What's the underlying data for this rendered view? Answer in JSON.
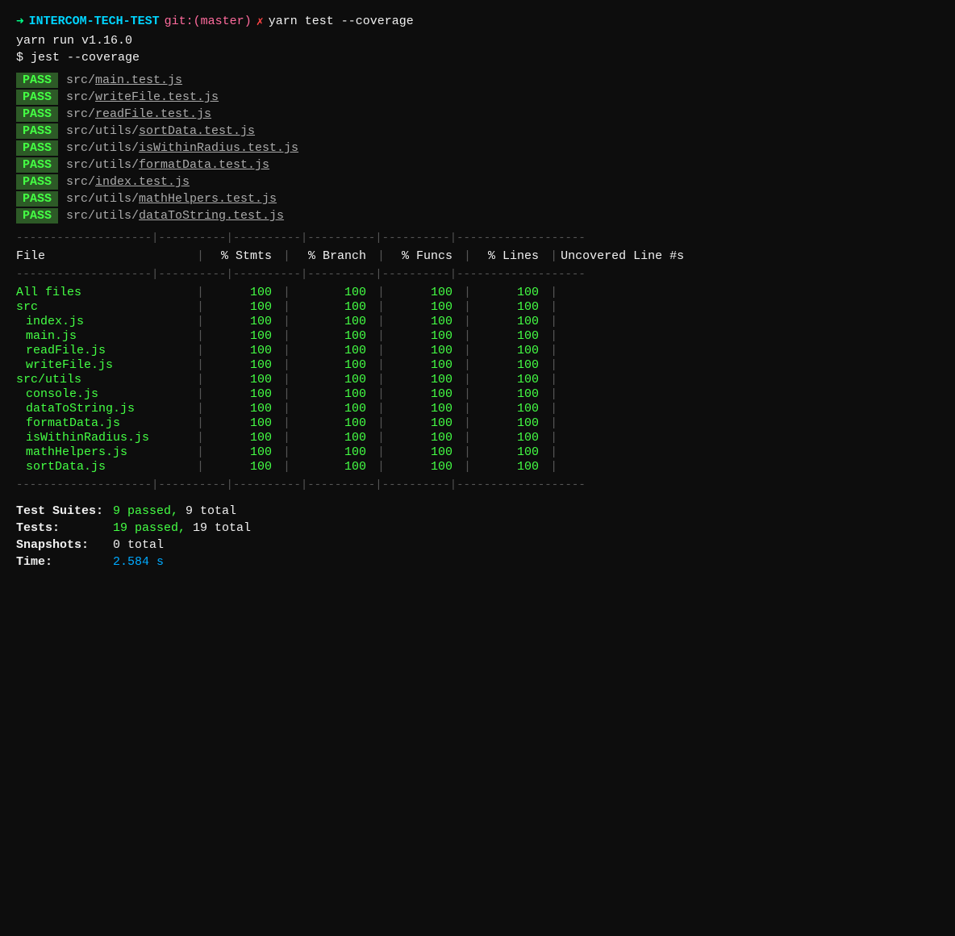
{
  "terminal": {
    "prompt": {
      "arrow": "➜",
      "dir": "INTERCOM-TECH-TEST",
      "git_label": "git:",
      "branch": "(master)",
      "cross": "✗",
      "command": "yarn test --coverage"
    },
    "yarn_version": "yarn run v1.16.0",
    "jest_cmd": "$ jest --coverage",
    "pass_files": [
      "src/main.test.js",
      "src/writeFile.test.js",
      "src/readFile.test.js",
      "src/utils/sortData.test.js",
      "src/utils/isWithinRadius.test.js",
      "src/utils/formatData.test.js",
      "src/index.test.js",
      "src/utils/mathHelpers.test.js",
      "src/utils/dataToString.test.js"
    ],
    "table": {
      "headers": {
        "file": "File",
        "stmts": "% Stmts",
        "branch": "% Branch",
        "funcs": "% Funcs",
        "lines": "% Lines",
        "uncovered": "Uncovered Line #s"
      },
      "rows": [
        {
          "file": "All files",
          "stmts": "100",
          "branch": "100",
          "funcs": "100",
          "lines": "100",
          "uncovered": "",
          "type": "section"
        },
        {
          "file": "src",
          "stmts": "100",
          "branch": "100",
          "funcs": "100",
          "lines": "100",
          "uncovered": "",
          "type": "section"
        },
        {
          "file": "index.js",
          "stmts": "100",
          "branch": "100",
          "funcs": "100",
          "lines": "100",
          "uncovered": "",
          "type": "sub"
        },
        {
          "file": "main.js",
          "stmts": "100",
          "branch": "100",
          "funcs": "100",
          "lines": "100",
          "uncovered": "",
          "type": "sub"
        },
        {
          "file": "readFile.js",
          "stmts": "100",
          "branch": "100",
          "funcs": "100",
          "lines": "100",
          "uncovered": "",
          "type": "sub"
        },
        {
          "file": "writeFile.js",
          "stmts": "100",
          "branch": "100",
          "funcs": "100",
          "lines": "100",
          "uncovered": "",
          "type": "sub"
        },
        {
          "file": "src/utils",
          "stmts": "100",
          "branch": "100",
          "funcs": "100",
          "lines": "100",
          "uncovered": "",
          "type": "section"
        },
        {
          "file": "console.js",
          "stmts": "100",
          "branch": "100",
          "funcs": "100",
          "lines": "100",
          "uncovered": "",
          "type": "sub"
        },
        {
          "file": "dataToString.js",
          "stmts": "100",
          "branch": "100",
          "funcs": "100",
          "lines": "100",
          "uncovered": "",
          "type": "sub"
        },
        {
          "file": "formatData.js",
          "stmts": "100",
          "branch": "100",
          "funcs": "100",
          "lines": "100",
          "uncovered": "",
          "type": "sub"
        },
        {
          "file": "isWithinRadius.js",
          "stmts": "100",
          "branch": "100",
          "funcs": "100",
          "lines": "100",
          "uncovered": "",
          "type": "sub"
        },
        {
          "file": "mathHelpers.js",
          "stmts": "100",
          "branch": "100",
          "funcs": "100",
          "lines": "100",
          "uncovered": "",
          "type": "sub"
        },
        {
          "file": "sortData.js",
          "stmts": "100",
          "branch": "100",
          "funcs": "100",
          "lines": "100",
          "uncovered": "",
          "type": "sub"
        }
      ]
    },
    "summary": {
      "suites_label": "Test Suites:",
      "suites_passed": "9 passed,",
      "suites_total": "9 total",
      "tests_label": "Tests:",
      "tests_passed": "19 passed,",
      "tests_total": "19 total",
      "snapshots_label": "Snapshots:",
      "snapshots_value": "0 total",
      "time_label": "Time:",
      "time_value": "2.584 s"
    }
  }
}
